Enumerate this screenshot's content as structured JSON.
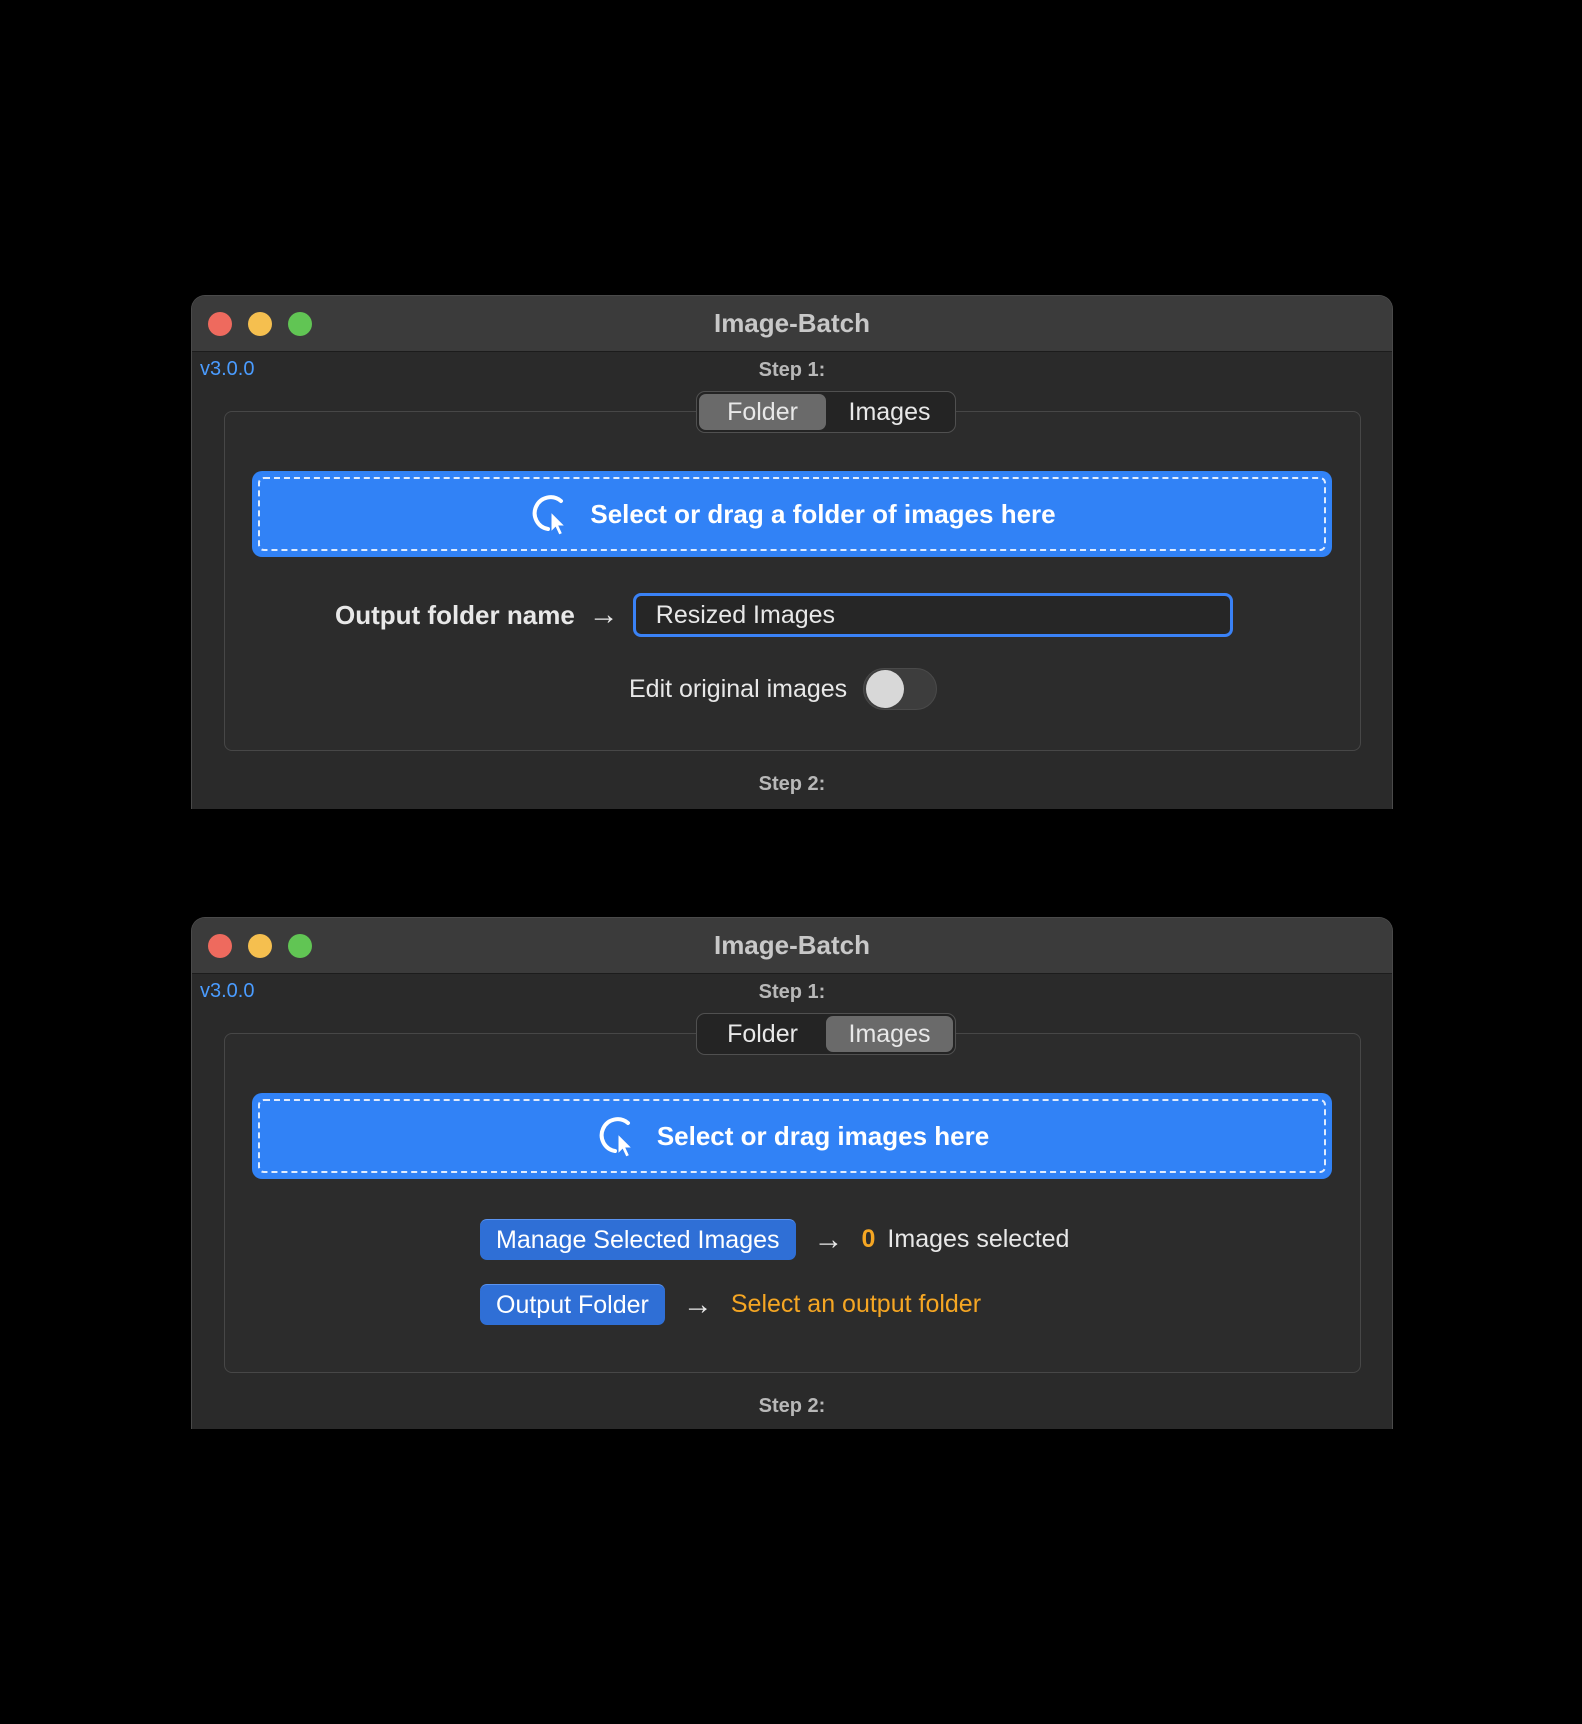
{
  "windows": [
    {
      "title": "Image-Batch",
      "version": "v3.0.0",
      "step1_label": "Step 1:",
      "step2_label": "Step 2:",
      "tabs": [
        {
          "label": "Folder",
          "active": true
        },
        {
          "label": "Images",
          "active": false
        }
      ],
      "dropzone_label": "Select or drag a folder of images here",
      "output_label": "Output folder name",
      "output_value": "Resized Images",
      "edit_original_label": "Edit original images",
      "edit_original_on": false
    },
    {
      "title": "Image-Batch",
      "version": "v3.0.0",
      "step1_label": "Step 1:",
      "step2_label": "Step 2:",
      "tabs": [
        {
          "label": "Folder",
          "active": false
        },
        {
          "label": "Images",
          "active": true
        }
      ],
      "dropzone_label": "Select or drag images here",
      "manage_button": "Manage Selected Images",
      "selected_count": "0",
      "selected_text": "Images selected",
      "output_button": "Output Folder",
      "output_status": "Select an output folder"
    }
  ],
  "arrow_glyph": "→",
  "icons": {
    "dropzone": "click-cursor-icon"
  },
  "colors": {
    "accent": "#3182f6",
    "warning": "#f5a623",
    "version": "#4a9cff"
  }
}
